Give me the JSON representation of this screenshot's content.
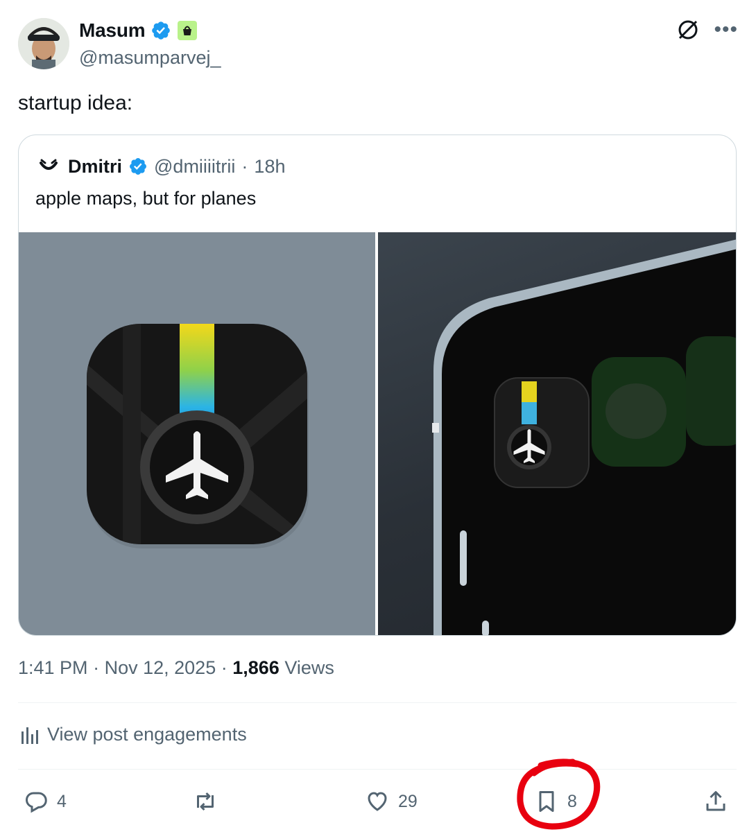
{
  "author": {
    "display_name": "Masum",
    "handle": "@masumparvej_",
    "avatar": "avatar-photo",
    "verified_icon": "verified-badge-icon",
    "badge_icon": "shopping-bag-badge-icon"
  },
  "top_icons": [
    "grok-icon",
    "more-icon"
  ],
  "tweet": {
    "text": "startup idea:"
  },
  "quoted": {
    "display_name": "Dmitri",
    "handle": "@dmiiiitrii",
    "separator": "·",
    "time": "18h",
    "text": "apple maps, but for planes",
    "images": [
      "flighty-app-icon-image",
      "phone-home-screen-image"
    ]
  },
  "meta": {
    "time": "1:41 PM",
    "sep1": "·",
    "date": "Nov 12, 2025",
    "sep2": "·",
    "views_count": "1,866",
    "views_label": "Views"
  },
  "engagements": {
    "label": "View post engagements",
    "icon": "bar-chart-icon"
  },
  "actions": {
    "reply_count": "4",
    "repost_count": "",
    "like_count": "29",
    "bookmark_count": "8",
    "share": ""
  },
  "colors": {
    "text": "#0f1419",
    "secondary": "#536471",
    "border": "#cfd9de",
    "verified": "#1d9bf0",
    "annotation": "#e8000f"
  }
}
